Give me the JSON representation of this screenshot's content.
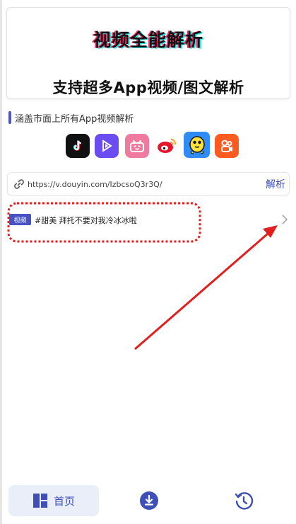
{
  "banner": {
    "title": "视频全能解析",
    "subtitle": "支持超多App视频/图文解析"
  },
  "section": {
    "title": "涵盖市面上所有App视频解析"
  },
  "apps": [
    {
      "icon": "tiktok-icon",
      "color": "#111111"
    },
    {
      "icon": "video-play-icon",
      "color": "#6a4cf0"
    },
    {
      "icon": "bilibili-icon",
      "color": "#ef7aa0"
    },
    {
      "icon": "weibo-icon",
      "color": "#ff5a5a"
    },
    {
      "icon": "qq-penguin-icon",
      "color": "#2f8bf5"
    },
    {
      "icon": "kuaishou-icon",
      "color": "#ff5a1f"
    }
  ],
  "url_input": {
    "value": "https://v.douyin.com/IzbcsoQ3r3Q/",
    "parse_label": "解析"
  },
  "result": {
    "tag": "视频",
    "text": "#甜美  拜托不要对我冷冰冰啦"
  },
  "nav": {
    "home_label": "首页",
    "items": [
      "home-icon",
      "download-icon",
      "history-icon"
    ]
  },
  "colors": {
    "accent": "#3f4fb8",
    "annotation": "#e02020"
  }
}
